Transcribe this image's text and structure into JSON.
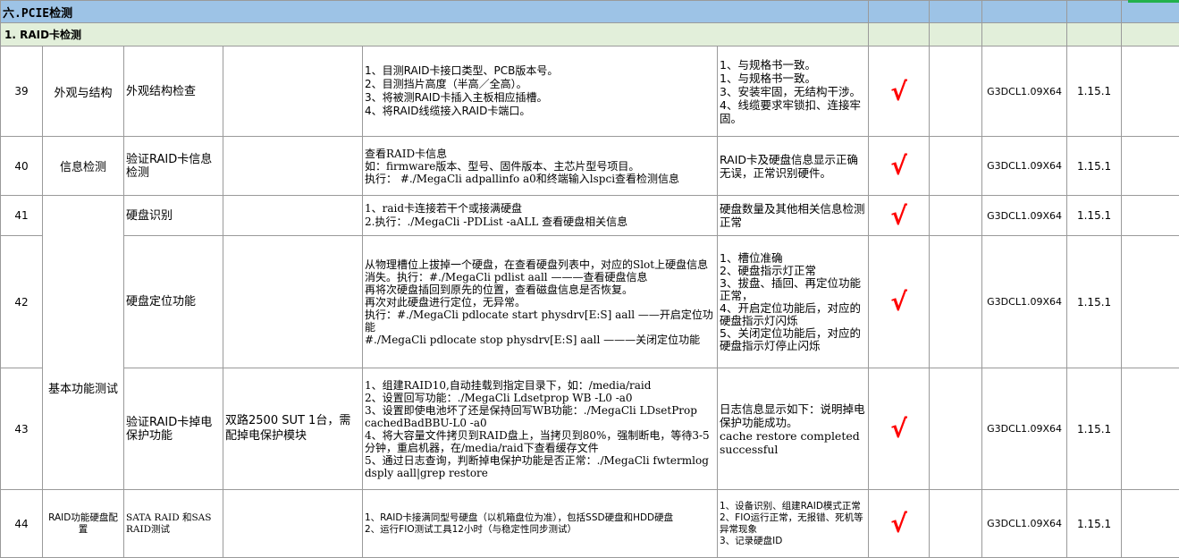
{
  "section": {
    "title": "六.PCIE检测"
  },
  "subsection": {
    "title": "1.  RAID卡检测"
  },
  "rows": [
    {
      "id": "39",
      "category": "外观与结构",
      "item": "外观结构检查",
      "env": "",
      "steps": "1、目测RAID卡接口类型、PCB版本号。\n2、目测挡片高度（半高／全高）。\n3、将被测RAID卡插入主板相应插槽。\n4、将RAID线缆接入RAID卡端口。",
      "expected": "1、与规格书一致。\n1、与规格书一致。\n3、安装牢固，无结构干涉。\n4、线缆要求牢锁扣、连接牢固。",
      "result": "√",
      "version": "G3DCL1.09X64",
      "release": "1.15.1"
    },
    {
      "id": "40",
      "category": "信息检测",
      "item": "验证RAID卡信息检测",
      "env": "",
      "steps": "查看RAID卡信息\n如：firmware版本、型号、固件版本、主芯片型号项目。\n执行： #./MegaCli adpallinfo a0和终端输入lspci查看检测信息",
      "expected": "RAID卡及硬盘信息显示正确无误，正常识别硬件。",
      "result": "√",
      "version": "G3DCL1.09X64",
      "release": "1.15.1"
    },
    {
      "id": "41",
      "category": "基本功能测试",
      "item": "硬盘识别",
      "env": "",
      "steps": "1、raid卡连接若干个或接满硬盘\n2.执行：./MegaCli -PDList -aALL    查看硬盘相关信息",
      "expected": "硬盘数量及其他相关信息检测正常",
      "result": "√",
      "version": "G3DCL1.09X64",
      "release": "1.15.1"
    },
    {
      "id": "42",
      "category": "",
      "item": "硬盘定位功能",
      "env": "",
      "steps": "从物理槽位上拔掉一个硬盘，在查看硬盘列表中，对应的Slot上硬盘信息消失。执行：#./MegaCli pdlist aall ———查看硬盘信息\n再将次硬盘插回到原先的位置，查看磁盘信息是否恢复。\n再次对此硬盘进行定位，无异常。\n执行：#./MegaCli pdlocate start physdrv[E:S] aall  ——开启定位功能\n#./MegaCli pdlocate  stop physdrv[E:S] aall ———关闭定位功能",
      "expected": "1、槽位准确\n2、硬盘指示灯正常\n3、拔盘、插回、再定位功能正常，\n4、开启定位功能后，对应的硬盘指示灯闪烁\n5、关闭定位功能后，对应的硬盘指示灯停止闪烁",
      "result": "√",
      "version": "G3DCL1.09X64",
      "release": "1.15.1"
    },
    {
      "id": "43",
      "category": "",
      "item": "验证RAID卡掉电保护功能",
      "env": "双路2500 SUT 1台，需配掉电保护模块",
      "steps": "1、组建RAID10,自动挂载到指定目录下，如：/media/raid\n2、设置回写功能：./MegaCli Ldsetprop WB -L0 -a0\n3、设置即使电池坏了还是保持回写WB功能：./MegaCli LDsetProp cachedBadBBU-L0 -a0\n4、将大容量文件拷贝到RAID盘上，当拷贝到80%，强制断电，等待3-5分钟，重启机器，在/media/raid下查看缓存文件\n5、通过日志查询，判断掉电保护功能是否正常：./MegaCli fwtermlog  dsply aall|grep restore",
      "expected": "日志信息显示如下：说明掉电保护功能成功。\ncache restore completed successful",
      "result": "√",
      "version": "G3DCL1.09X64",
      "release": "1.15.1"
    },
    {
      "id": "44",
      "category": "RAID功能硬盘配置",
      "item": "SATA RAID 和SAS RAID测试",
      "env": "",
      "steps": "1、RAID卡接满同型号硬盘（以机箱盘位为准），包括SSD硬盘和HDD硬盘\n2、运行FIO测试工具12小时（与稳定性同步测试）",
      "expected": "1、设备识别、组建RAID模式正常\n2、FIO运行正常，无报错、死机等异常现象\n3、记录硬盘ID",
      "result": "√",
      "version": "G3DCL1.09X64",
      "release": "1.15.1"
    }
  ]
}
